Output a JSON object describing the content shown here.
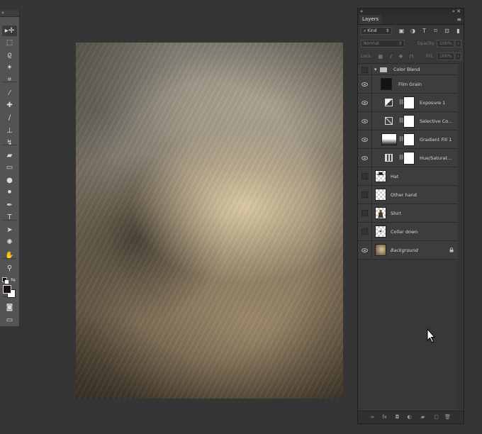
{
  "tools_panel": {
    "collapse_glyph": "»",
    "tools": [
      {
        "name": "move-tool",
        "glyph": "▸✛",
        "active": true
      },
      {
        "name": "marquee-tool",
        "glyph": "⬚"
      },
      {
        "name": "lasso-tool",
        "glyph": "ϱ"
      },
      {
        "name": "magic-wand-tool",
        "glyph": "✶"
      },
      {
        "name": "crop-tool",
        "glyph": "⌗"
      },
      {
        "name": "eyedropper-tool",
        "glyph": "⁄"
      },
      {
        "name": "healing-brush-tool",
        "glyph": "✚"
      },
      {
        "name": "brush-tool",
        "glyph": "∕"
      },
      {
        "name": "clone-stamp-tool",
        "glyph": "⊥"
      },
      {
        "name": "history-brush-tool",
        "glyph": "↯"
      },
      {
        "name": "eraser-tool",
        "glyph": "▰"
      },
      {
        "name": "gradient-tool",
        "glyph": "▭"
      },
      {
        "name": "blur-tool",
        "glyph": "●"
      },
      {
        "name": "dodge-tool",
        "glyph": "⚫"
      },
      {
        "name": "pen-tool",
        "glyph": "✒"
      },
      {
        "name": "type-tool",
        "glyph": "T"
      },
      {
        "name": "path-selection-tool",
        "glyph": "➤"
      },
      {
        "name": "custom-shape-tool",
        "glyph": "✺"
      },
      {
        "name": "hand-tool",
        "glyph": "✋"
      },
      {
        "name": "zoom-tool",
        "glyph": "⚲"
      },
      {
        "name": "quick-mask-tool",
        "glyph": "◙"
      },
      {
        "name": "screen-mode-tool",
        "glyph": "▭"
      }
    ],
    "foreground_color": "#1a0d18",
    "background_color": "#ffffff"
  },
  "layers_panel": {
    "topbar_left": "»",
    "topbar_right": "« ✕",
    "tab_title": "Layers",
    "menu_glyph": "≡",
    "filter_kind": "Kind",
    "filter_arrow": "⇕",
    "filter_icons": [
      "image-filter-icon",
      "adjustment-filter-icon",
      "type-filter-icon",
      "shape-filter-icon",
      "smart-object-filter-icon",
      "filter-toggle-icon"
    ],
    "blend_mode": "Normal",
    "opacity_label": "Opacity:",
    "opacity_value": "100%",
    "lock_label": "Lock:",
    "fill_label": "Fill:",
    "fill_value": "100%",
    "layers": [
      {
        "name": "Color Blend",
        "type": "group",
        "visible": false
      },
      {
        "name": "Film Grain",
        "type": "fill",
        "visible": true,
        "thumb_color": "#141414"
      },
      {
        "name": "Exposure 1",
        "type": "adjustment",
        "visible": true,
        "icon": "exposure-icon"
      },
      {
        "name": "Selective Co...",
        "type": "adjustment",
        "visible": true,
        "icon": "selective-color-icon"
      },
      {
        "name": "Gradient Fill 1",
        "type": "gradient",
        "visible": true
      },
      {
        "name": "Hue/Saturat...",
        "type": "adjustment",
        "visible": true,
        "icon": "hue-saturation-icon"
      },
      {
        "name": "Hat",
        "type": "pixel",
        "visible": false
      },
      {
        "name": "Other hand",
        "type": "pixel",
        "visible": false
      },
      {
        "name": "Shirt",
        "type": "pixel",
        "visible": false
      },
      {
        "name": "Collar down",
        "type": "pixel",
        "visible": false
      },
      {
        "name": "Background",
        "type": "background",
        "visible": true,
        "locked": true
      }
    ],
    "footer_buttons": [
      {
        "name": "link-layers-icon",
        "glyph": "∞"
      },
      {
        "name": "add-style-icon",
        "glyph": "fx"
      },
      {
        "name": "add-mask-icon",
        "glyph": "◘"
      },
      {
        "name": "new-adjustment-icon",
        "glyph": "◐"
      },
      {
        "name": "new-group-icon",
        "glyph": "▰"
      },
      {
        "name": "new-layer-icon",
        "glyph": "▢"
      },
      {
        "name": "delete-layer-icon",
        "glyph": "🗑"
      }
    ]
  }
}
